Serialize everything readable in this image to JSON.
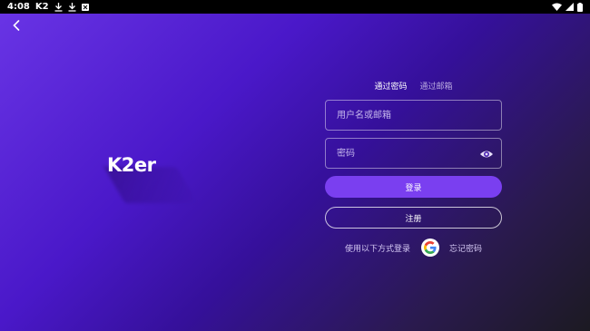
{
  "status_bar": {
    "time": "4:08",
    "app_badge": "K2",
    "icons": [
      "download-icon",
      "download-icon",
      "notification-box-icon",
      "wifi-icon",
      "signal-icon",
      "battery-icon"
    ]
  },
  "logo": {
    "text": "K2er"
  },
  "tabs": [
    {
      "label": "通过密码",
      "active": true
    },
    {
      "label": "通过邮箱",
      "active": false
    }
  ],
  "form": {
    "username_placeholder": "用户名或邮箱",
    "password_placeholder": "密码",
    "login_label": "登录",
    "register_label": "注册"
  },
  "alt_login": {
    "label": "使用以下方式登录",
    "forgot_label": "忘记密码"
  },
  "colors": {
    "primary_button": "#7a3ff0",
    "background_start": "#6a35e6",
    "background_end": "#1c1a22"
  }
}
